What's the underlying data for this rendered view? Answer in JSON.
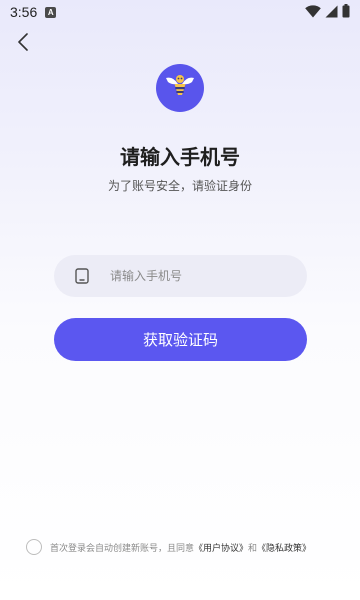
{
  "status_bar": {
    "time": "3:56",
    "app_icon_letter": "A"
  },
  "login": {
    "title": "请输入手机号",
    "subtitle": "为了账号安全，请验证身份",
    "phone_placeholder": "请输入手机号",
    "phone_value": "",
    "get_code_label": "获取验证码"
  },
  "agreement": {
    "prefix": "首次登录会自动创建新账号，且同意",
    "user_agreement": "《用户协议》",
    "conjunction": "和",
    "privacy_policy": "《隐私政策》",
    "checked": false
  },
  "colors": {
    "accent": "#5b57f0",
    "input_bg": "#ececf6",
    "logo_bg": "#5955ec"
  },
  "icons": {
    "back": "chevron-left-icon",
    "logo": "bee-logo-icon",
    "phone": "phone-icon",
    "wifi": "wifi-icon",
    "signal": "signal-icon",
    "battery": "battery-icon"
  }
}
